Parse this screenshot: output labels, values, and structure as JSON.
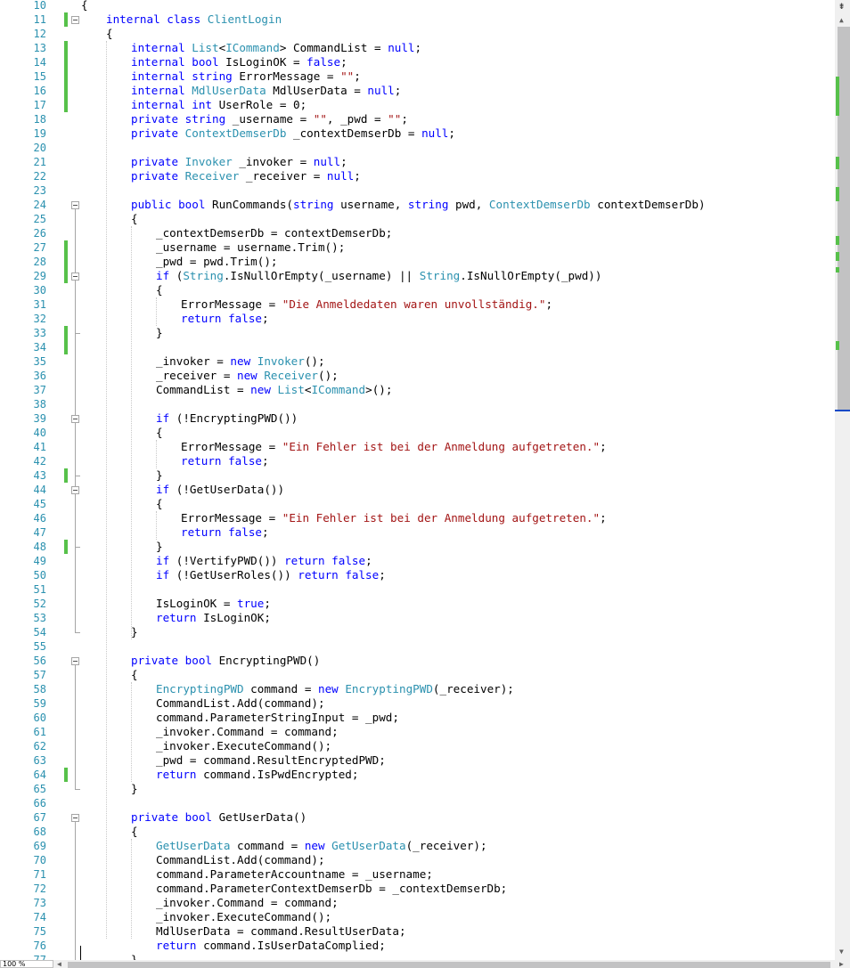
{
  "editor": {
    "zoom_label": "100 %",
    "splitter_icon": "split-icon",
    "up_arrow": "▲",
    "down_arrow": "▼",
    "left_arrow": "◀",
    "right_arrow": "▶",
    "colors": {
      "keyword": "#0000ff",
      "type": "#2b91af",
      "string": "#a31515",
      "line_number": "#2b91af",
      "change_bar": "#57c14a"
    }
  },
  "gutter": {
    "line_numbers": [
      "10",
      "11",
      "12",
      "13",
      "14",
      "15",
      "16",
      "17",
      "18",
      "19",
      "20",
      "21",
      "22",
      "23",
      "24",
      "25",
      "26",
      "27",
      "28",
      "29",
      "30",
      "31",
      "32",
      "33",
      "34",
      "35",
      "36",
      "37",
      "38",
      "39",
      "40",
      "41",
      "42",
      "43",
      "44",
      "45",
      "46",
      "47",
      "48",
      "49",
      "50",
      "51",
      "52",
      "53",
      "54",
      "55",
      "56",
      "57",
      "58",
      "59",
      "60",
      "61",
      "62",
      "63",
      "64",
      "65",
      "66",
      "67",
      "68",
      "69",
      "70",
      "71",
      "72",
      "73",
      "74",
      "75",
      "76",
      "77"
    ]
  },
  "code": {
    "lines": [
      [
        [
          "p",
          "{"
        ]
      ],
      [
        [
          "k",
          "internal "
        ],
        [
          "k",
          "class "
        ],
        [
          "t",
          "ClientLogin"
        ]
      ],
      [
        [
          "p",
          "{"
        ]
      ],
      [
        [
          "k",
          "internal "
        ],
        [
          "t",
          "List"
        ],
        [
          "p",
          "<"
        ],
        [
          "t",
          "ICommand"
        ],
        [
          "p",
          "> CommandList = "
        ],
        [
          "k",
          "null"
        ],
        [
          "p",
          ";"
        ]
      ],
      [
        [
          "k",
          "internal "
        ],
        [
          "k",
          "bool "
        ],
        [
          "p",
          "IsLoginOK = "
        ],
        [
          "k",
          "false"
        ],
        [
          "p",
          ";"
        ]
      ],
      [
        [
          "k",
          "internal "
        ],
        [
          "k",
          "string "
        ],
        [
          "p",
          "ErrorMessage = "
        ],
        [
          "s",
          "\"\""
        ],
        [
          "p",
          ";"
        ]
      ],
      [
        [
          "k",
          "internal "
        ],
        [
          "t",
          "MdlUserData "
        ],
        [
          "p",
          "MdlUserData = "
        ],
        [
          "k",
          "null"
        ],
        [
          "p",
          ";"
        ]
      ],
      [
        [
          "k",
          "internal "
        ],
        [
          "k",
          "int "
        ],
        [
          "p",
          "UserRole = 0;"
        ]
      ],
      [
        [
          "k",
          "private "
        ],
        [
          "k",
          "string "
        ],
        [
          "p",
          "_username = "
        ],
        [
          "s",
          "\"\""
        ],
        [
          "p",
          ", _pwd = "
        ],
        [
          "s",
          "\"\""
        ],
        [
          "p",
          ";"
        ]
      ],
      [
        [
          "k",
          "private "
        ],
        [
          "t",
          "ContextDemserDb "
        ],
        [
          "p",
          "_contextDemserDb = "
        ],
        [
          "k",
          "null"
        ],
        [
          "p",
          ";"
        ]
      ],
      [],
      [
        [
          "k",
          "private "
        ],
        [
          "t",
          "Invoker "
        ],
        [
          "p",
          "_invoker = "
        ],
        [
          "k",
          "null"
        ],
        [
          "p",
          ";"
        ]
      ],
      [
        [
          "k",
          "private "
        ],
        [
          "t",
          "Receiver "
        ],
        [
          "p",
          "_receiver = "
        ],
        [
          "k",
          "null"
        ],
        [
          "p",
          ";"
        ]
      ],
      [],
      [
        [
          "k",
          "public "
        ],
        [
          "k",
          "bool "
        ],
        [
          "p",
          "RunCommands("
        ],
        [
          "k",
          "string "
        ],
        [
          "p",
          "username, "
        ],
        [
          "k",
          "string "
        ],
        [
          "p",
          "pwd, "
        ],
        [
          "t",
          "ContextDemserDb "
        ],
        [
          "p",
          "contextDemserDb)"
        ]
      ],
      [
        [
          "p",
          "{"
        ]
      ],
      [
        [
          "p",
          "_contextDemserDb = contextDemserDb;"
        ]
      ],
      [
        [
          "p",
          "_username = username.Trim();"
        ]
      ],
      [
        [
          "p",
          "_pwd = pwd.Trim();"
        ]
      ],
      [
        [
          "k",
          "if "
        ],
        [
          "p",
          "("
        ],
        [
          "t",
          "String"
        ],
        [
          "p",
          ".IsNullOrEmpty(_username) || "
        ],
        [
          "t",
          "String"
        ],
        [
          "p",
          ".IsNullOrEmpty(_pwd))"
        ]
      ],
      [
        [
          "p",
          "{"
        ]
      ],
      [
        [
          "p",
          "ErrorMessage = "
        ],
        [
          "s",
          "\"Die Anmeldedaten waren unvollständig.\""
        ],
        [
          "p",
          ";"
        ]
      ],
      [
        [
          "k",
          "return "
        ],
        [
          "k",
          "false"
        ],
        [
          "p",
          ";"
        ]
      ],
      [
        [
          "p",
          "}"
        ]
      ],
      [],
      [
        [
          "p",
          "_invoker = "
        ],
        [
          "k",
          "new "
        ],
        [
          "t",
          "Invoker"
        ],
        [
          "p",
          "();"
        ]
      ],
      [
        [
          "p",
          "_receiver = "
        ],
        [
          "k",
          "new "
        ],
        [
          "t",
          "Receiver"
        ],
        [
          "p",
          "();"
        ]
      ],
      [
        [
          "p",
          "CommandList = "
        ],
        [
          "k",
          "new "
        ],
        [
          "t",
          "List"
        ],
        [
          "p",
          "<"
        ],
        [
          "t",
          "ICommand"
        ],
        [
          "p",
          ">();"
        ]
      ],
      [],
      [
        [
          "k",
          "if "
        ],
        [
          "p",
          "(!EncryptingPWD())"
        ]
      ],
      [
        [
          "p",
          "{"
        ]
      ],
      [
        [
          "p",
          "ErrorMessage = "
        ],
        [
          "s",
          "\"Ein Fehler ist bei der Anmeldung aufgetreten.\""
        ],
        [
          "p",
          ";"
        ]
      ],
      [
        [
          "k",
          "return "
        ],
        [
          "k",
          "false"
        ],
        [
          "p",
          ";"
        ]
      ],
      [
        [
          "p",
          "}"
        ]
      ],
      [
        [
          "k",
          "if "
        ],
        [
          "p",
          "(!GetUserData())"
        ]
      ],
      [
        [
          "p",
          "{"
        ]
      ],
      [
        [
          "p",
          "ErrorMessage = "
        ],
        [
          "s",
          "\"Ein Fehler ist bei der Anmeldung aufgetreten.\""
        ],
        [
          "p",
          ";"
        ]
      ],
      [
        [
          "k",
          "return "
        ],
        [
          "k",
          "false"
        ],
        [
          "p",
          ";"
        ]
      ],
      [
        [
          "p",
          "}"
        ]
      ],
      [
        [
          "k",
          "if "
        ],
        [
          "p",
          "(!VertifyPWD()) "
        ],
        [
          "k",
          "return "
        ],
        [
          "k",
          "false"
        ],
        [
          "p",
          ";"
        ]
      ],
      [
        [
          "k",
          "if "
        ],
        [
          "p",
          "(!GetUserRoles()) "
        ],
        [
          "k",
          "return "
        ],
        [
          "k",
          "false"
        ],
        [
          "p",
          ";"
        ]
      ],
      [],
      [
        [
          "p",
          "IsLoginOK = "
        ],
        [
          "k",
          "true"
        ],
        [
          "p",
          ";"
        ]
      ],
      [
        [
          "k",
          "return "
        ],
        [
          "p",
          "IsLoginOK;"
        ]
      ],
      [
        [
          "p",
          "}"
        ]
      ],
      [],
      [
        [
          "k",
          "private "
        ],
        [
          "k",
          "bool "
        ],
        [
          "p",
          "EncryptingPWD()"
        ]
      ],
      [
        [
          "p",
          "{"
        ]
      ],
      [
        [
          "t",
          "EncryptingPWD "
        ],
        [
          "p",
          "command = "
        ],
        [
          "k",
          "new "
        ],
        [
          "t",
          "EncryptingPWD"
        ],
        [
          "p",
          "(_receiver);"
        ]
      ],
      [
        [
          "p",
          "CommandList.Add(command);"
        ]
      ],
      [
        [
          "p",
          "command.ParameterStringInput = _pwd;"
        ]
      ],
      [
        [
          "p",
          "_invoker.Command = command;"
        ]
      ],
      [
        [
          "p",
          "_invoker.ExecuteCommand();"
        ]
      ],
      [
        [
          "p",
          "_pwd = command.ResultEncryptedPWD;"
        ]
      ],
      [
        [
          "k",
          "return "
        ],
        [
          "p",
          "command.IsPwdEncrypted;"
        ]
      ],
      [
        [
          "p",
          "}"
        ]
      ],
      [],
      [
        [
          "k",
          "private "
        ],
        [
          "k",
          "bool "
        ],
        [
          "p",
          "GetUserData()"
        ]
      ],
      [
        [
          "p",
          "{"
        ]
      ],
      [
        [
          "t",
          "GetUserData "
        ],
        [
          "p",
          "command = "
        ],
        [
          "k",
          "new "
        ],
        [
          "t",
          "GetUserData"
        ],
        [
          "p",
          "(_receiver);"
        ]
      ],
      [
        [
          "p",
          "CommandList.Add(command);"
        ]
      ],
      [
        [
          "p",
          "command.ParameterAccountname = _username;"
        ]
      ],
      [
        [
          "p",
          "command.ParameterContextDemserDb = _contextDemserDb;"
        ]
      ],
      [
        [
          "p",
          "_invoker.Command = command;"
        ]
      ],
      [
        [
          "p",
          "_invoker.ExecuteCommand();"
        ]
      ],
      [
        [
          "p",
          "MdlUserData = command.ResultUserData;"
        ]
      ],
      [
        [
          "k",
          "return "
        ],
        [
          "p",
          "command.IsUserDataComplied;"
        ]
      ],
      [
        [
          "p",
          "}"
        ]
      ]
    ]
  }
}
